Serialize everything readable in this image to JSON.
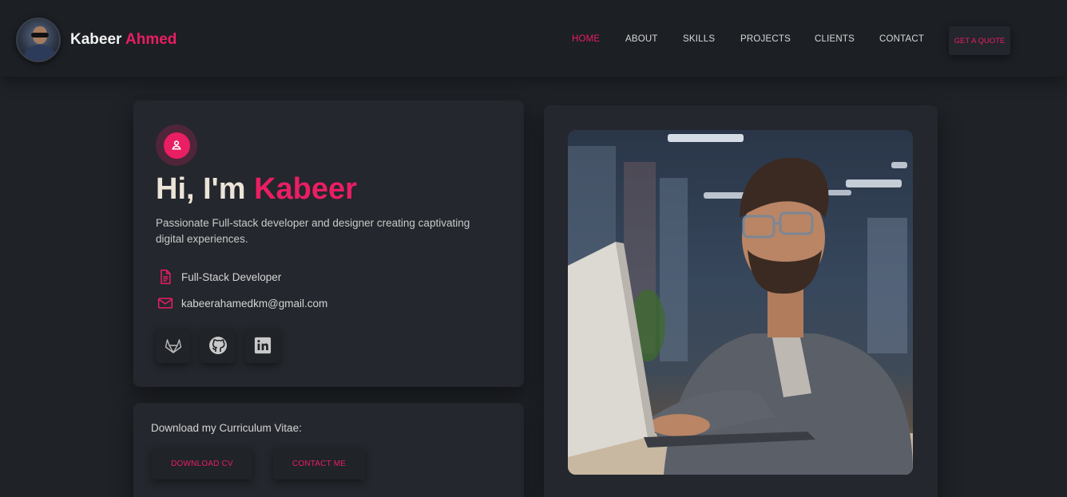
{
  "brand": {
    "first": "Kabeer",
    "last": "Ahmed"
  },
  "nav": {
    "items": [
      {
        "label": "HOME",
        "active": true
      },
      {
        "label": "ABOUT",
        "active": false
      },
      {
        "label": "SKILLS",
        "active": false
      },
      {
        "label": "PROJECTS",
        "active": false
      },
      {
        "label": "CLIENTS",
        "active": false
      },
      {
        "label": "CONTACT",
        "active": false
      }
    ],
    "quote_label": "GET A QUOTE"
  },
  "intro": {
    "greeting": "Hi, I'm",
    "name": "Kabeer",
    "tagline": "Passionate Full-stack developer and designer creating captivating digital experiences.",
    "role": "Full-Stack Developer",
    "email": "kabeerahamedkm@gmail.com",
    "social": [
      "gitlab-icon",
      "github-icon",
      "linkedin-icon"
    ]
  },
  "cv": {
    "label": "Download my Curriculum Vitae:",
    "download_label": "DOWNLOAD CV",
    "contact_label": "CONTACT ME"
  },
  "colors": {
    "accent": "#e91e63",
    "background": "#1f2227",
    "card": "#24272d"
  }
}
